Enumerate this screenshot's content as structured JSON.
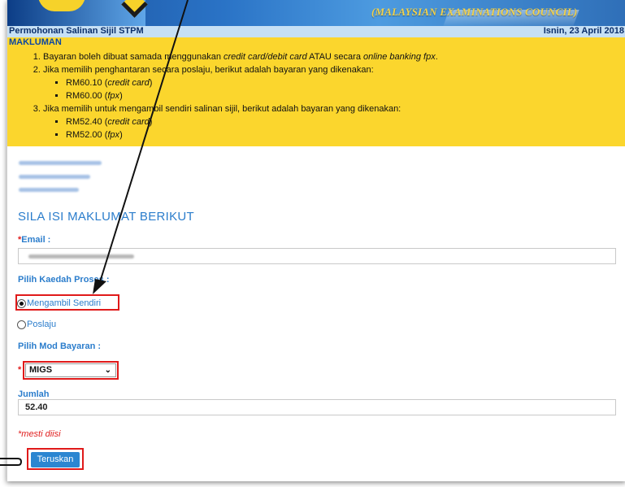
{
  "header": {
    "council_name": "(MALAYSIAN EXAMINATIONS COUNCIL)",
    "page_title": "Permohonan Salinan Sijil STPM",
    "date": "Isnin, 23 April 2018"
  },
  "notice": {
    "heading": "MAKLUMAN",
    "item1_a": "Bayaran boleh dibuat samada menggunakan ",
    "item1_b": "credit card/debit card",
    "item1_c": " ATAU secara ",
    "item1_d": "online banking fpx",
    "item1_e": ".",
    "item2": "Jika memilih penghantaran secara poslaju, berikut adalah bayaran yang dikenakan:",
    "item2_fee1_amount": "RM60.10",
    "item2_fee1_method": "credit card",
    "item2_fee2_amount": "RM60.00",
    "item2_fee2_method": "fpx",
    "item3": "Jika memilih untuk mengambil sendiri salinan sijil, berikut adalah bayaran yang dikenakan:",
    "item3_fee1_amount": "RM52.40",
    "item3_fee1_method": "credit card",
    "item3_fee2_amount": "RM52.00",
    "item3_fee2_method": "fpx"
  },
  "form": {
    "section_title": "SILA ISI MAKLUMAT BERIKUT",
    "required_mark": "*",
    "email_label": "Email :",
    "process_label": "Pilih Kaedah Proses :",
    "option_pickup": "Mengambil Sendiri",
    "option_poslaju": "Poslaju",
    "payment_label": "Pilih Mod Bayaran :",
    "payment_selected": "MIGS",
    "amount_label": "Jumlah",
    "amount_value": "52.40",
    "required_note": "*mesti diisi",
    "submit_label": "Teruskan"
  },
  "icons": {
    "dropdown": "chevron-down-icon",
    "radio_selected": "radio-checked-icon",
    "radio_empty": "radio-unchecked-icon"
  },
  "colors": {
    "notice_bg": "#fbd62d",
    "accent": "#2b7dcc",
    "highlight": "#e01a1a",
    "button": "#2b86d1"
  }
}
